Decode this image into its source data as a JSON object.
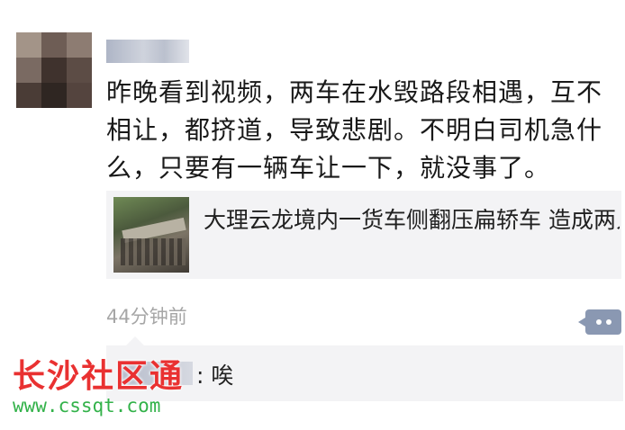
{
  "post": {
    "text": "昨晚看到视频，两车在水毁路段相遇，互不相让，都挤道，导致悲剧。不明白司机急什么，只要有一辆车让一下，就没事了。",
    "link": {
      "title": "大理云龙境内一货车侧翻压扁轿车 造成两人死亡、一人受伤_都市时报 i昆"
    },
    "timestamp": "44分钟前",
    "comment": {
      "text": ": 唉"
    }
  },
  "watermark": {
    "title": "长沙社区通",
    "url": "www.cssqt.com"
  },
  "colors": {
    "more_button": "#8a98b2",
    "watermark_red": "#e93131",
    "watermark_green": "#33b24a"
  }
}
